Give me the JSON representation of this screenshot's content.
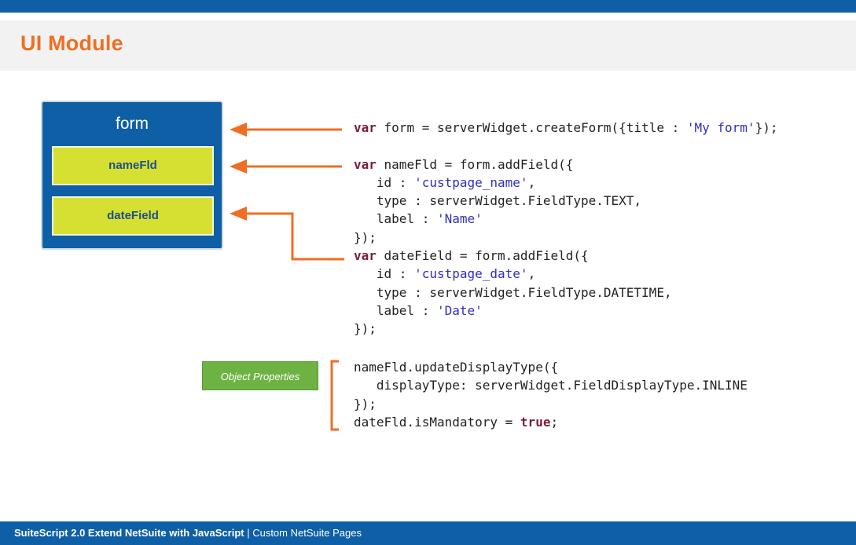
{
  "slide": {
    "title": "UI Module"
  },
  "form_diagram": {
    "form_label": "form",
    "fields": [
      "nameFld",
      "dateField"
    ]
  },
  "code_main": [
    [
      [
        "kw",
        "var"
      ],
      [
        "txt",
        " form = serverWidget.createForm({title : "
      ],
      [
        "str",
        "'My form'"
      ],
      [
        "txt",
        "});"
      ]
    ],
    [
      [
        "txt",
        ""
      ]
    ],
    [
      [
        "kw",
        "var"
      ],
      [
        "txt",
        " nameFld = form.addField({"
      ]
    ],
    [
      [
        "txt",
        "   id : "
      ],
      [
        "str",
        "'custpage_name'"
      ],
      [
        "txt",
        ","
      ]
    ],
    [
      [
        "txt",
        "   type : serverWidget.FieldType.TEXT,"
      ]
    ],
    [
      [
        "txt",
        "   label : "
      ],
      [
        "str",
        "'Name'"
      ]
    ],
    [
      [
        "txt",
        "});"
      ]
    ],
    [
      [
        "kw",
        "var"
      ],
      [
        "txt",
        " dateField = form.addField({"
      ]
    ],
    [
      [
        "txt",
        "   id : "
      ],
      [
        "str",
        "'custpage_date'"
      ],
      [
        "txt",
        ","
      ]
    ],
    [
      [
        "txt",
        "   type : serverWidget.FieldType.DATETIME,"
      ]
    ],
    [
      [
        "txt",
        "   label : "
      ],
      [
        "str",
        "'Date'"
      ]
    ],
    [
      [
        "txt",
        "});"
      ]
    ]
  ],
  "code_props": [
    [
      [
        "txt",
        "nameFld.updateDisplayType({"
      ]
    ],
    [
      [
        "txt",
        "   displayType: serverWidget.FieldDisplayType.INLINE"
      ]
    ],
    [
      [
        "txt",
        "});"
      ]
    ],
    [
      [
        "txt",
        "dateFld.isMandatory = "
      ],
      [
        "kw",
        "true"
      ],
      [
        "txt",
        ";"
      ]
    ]
  ],
  "object_properties_label": "Object Properties",
  "footer": {
    "course": "SuiteScript 2.0 Extend NetSuite with JavaScript",
    "separator": " | ",
    "section": "Custom NetSuite Pages"
  },
  "colors": {
    "brand_blue": "#0e5fa6",
    "accent_orange": "#ee6f23",
    "field_yellow_green": "#d6e032",
    "object_props_green": "#6fb244",
    "keyword": "#7a1f3d",
    "string": "#2f2fbf"
  }
}
